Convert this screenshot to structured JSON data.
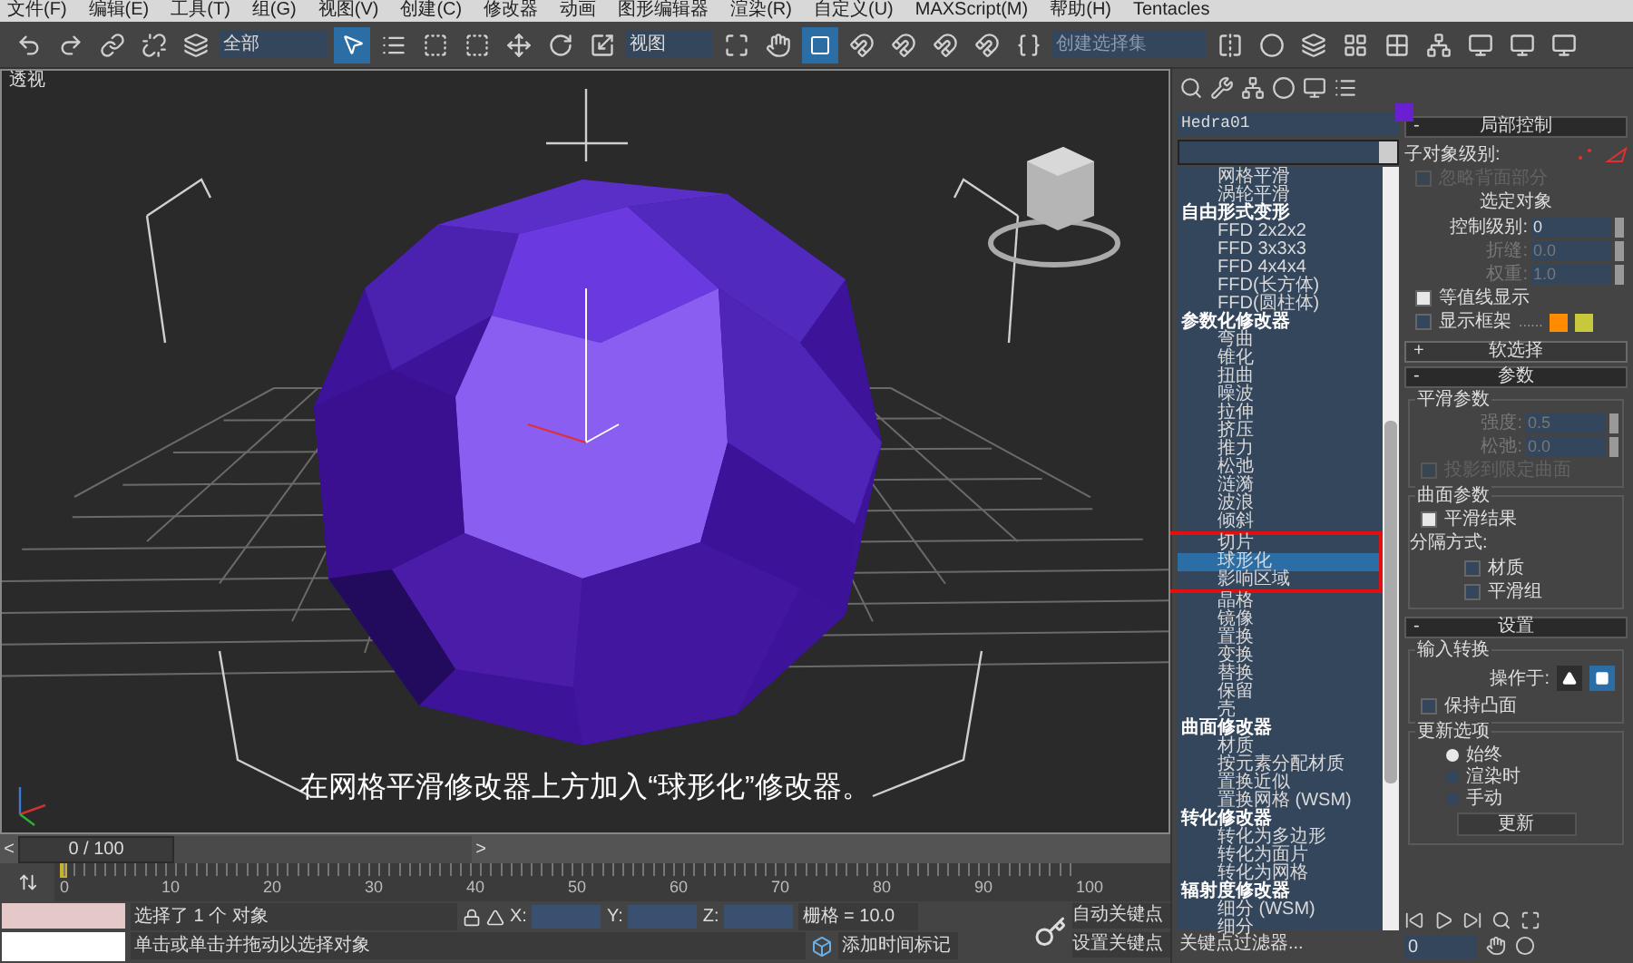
{
  "menu": [
    "文件(F)",
    "编辑(E)",
    "工具(T)",
    "组(G)",
    "视图(V)",
    "创建(C)",
    "修改器",
    "动画",
    "图形编辑器",
    "渲染(R)",
    "自定义(U)",
    "MAXScript(M)",
    "帮助(H)",
    "Tentacles"
  ],
  "toolbar": {
    "selection_filter": "全部",
    "reference_coord": "视图",
    "named_selection_placeholder": "创建选择集"
  },
  "viewport": {
    "label": "透视",
    "caption": "在网格平滑修改器上方加入“球形化”修改器。"
  },
  "command_panel": {
    "object": {
      "name": "Hedra01",
      "color": "#6a1fd0"
    },
    "modifier_list": [
      {
        "kind": "item",
        "label": "网格平滑",
        "selected": false,
        "marked": false
      },
      {
        "kind": "item",
        "label": "涡轮平滑",
        "selected": false,
        "marked": false
      },
      {
        "kind": "header",
        "label": "自由形式变形",
        "selected": false,
        "marked": false
      },
      {
        "kind": "item",
        "label": "FFD 2x2x2",
        "selected": false,
        "marked": false
      },
      {
        "kind": "item",
        "label": "FFD 3x3x3",
        "selected": false,
        "marked": false
      },
      {
        "kind": "item",
        "label": "FFD 4x4x4",
        "selected": false,
        "marked": false
      },
      {
        "kind": "item",
        "label": "FFD(长方体)",
        "selected": false,
        "marked": false
      },
      {
        "kind": "item",
        "label": "FFD(圆柱体)",
        "selected": false,
        "marked": false
      },
      {
        "kind": "header",
        "label": "参数化修改器",
        "selected": false,
        "marked": false
      },
      {
        "kind": "item",
        "label": "弯曲",
        "selected": false,
        "marked": false
      },
      {
        "kind": "item",
        "label": "锥化",
        "selected": false,
        "marked": false
      },
      {
        "kind": "item",
        "label": "扭曲",
        "selected": false,
        "marked": false
      },
      {
        "kind": "item",
        "label": "噪波",
        "selected": false,
        "marked": false
      },
      {
        "kind": "item",
        "label": "拉伸",
        "selected": false,
        "marked": false
      },
      {
        "kind": "item",
        "label": "挤压",
        "selected": false,
        "marked": false
      },
      {
        "kind": "item",
        "label": "推力",
        "selected": false,
        "marked": false
      },
      {
        "kind": "item",
        "label": "松弛",
        "selected": false,
        "marked": false
      },
      {
        "kind": "item",
        "label": "涟漪",
        "selected": false,
        "marked": false
      },
      {
        "kind": "item",
        "label": "波浪",
        "selected": false,
        "marked": false
      },
      {
        "kind": "item",
        "label": "倾斜",
        "selected": false,
        "marked": false
      },
      {
        "kind": "item",
        "label": "切片",
        "selected": false,
        "marked": true
      },
      {
        "kind": "item",
        "label": "球形化",
        "selected": true,
        "marked": true
      },
      {
        "kind": "item",
        "label": "影响区域",
        "selected": false,
        "marked": true
      },
      {
        "kind": "item",
        "label": "晶格",
        "selected": false,
        "marked": false
      },
      {
        "kind": "item",
        "label": "镜像",
        "selected": false,
        "marked": false
      },
      {
        "kind": "item",
        "label": "置换",
        "selected": false,
        "marked": false
      },
      {
        "kind": "item",
        "label": "变换",
        "selected": false,
        "marked": false
      },
      {
        "kind": "item",
        "label": "替换",
        "selected": false,
        "marked": false
      },
      {
        "kind": "item",
        "label": "保留",
        "selected": false,
        "marked": false
      },
      {
        "kind": "item",
        "label": "壳",
        "selected": false,
        "marked": false
      },
      {
        "kind": "header",
        "label": "曲面修改器",
        "selected": false,
        "marked": false
      },
      {
        "kind": "item",
        "label": "材质",
        "selected": false,
        "marked": false
      },
      {
        "kind": "item",
        "label": "按元素分配材质",
        "selected": false,
        "marked": false
      },
      {
        "kind": "item",
        "label": "置换近似",
        "selected": false,
        "marked": false
      },
      {
        "kind": "item",
        "label": "置换网格 (WSM)",
        "selected": false,
        "marked": false
      },
      {
        "kind": "header",
        "label": "转化修改器",
        "selected": false,
        "marked": false
      },
      {
        "kind": "item",
        "label": "转化为多边形",
        "selected": false,
        "marked": false
      },
      {
        "kind": "item",
        "label": "转化为面片",
        "selected": false,
        "marked": false
      },
      {
        "kind": "item",
        "label": "转化为网格",
        "selected": false,
        "marked": false
      },
      {
        "kind": "header",
        "label": "辐射度修改器",
        "selected": false,
        "marked": false
      },
      {
        "kind": "item",
        "label": "细分 (WSM)",
        "selected": false,
        "marked": false
      },
      {
        "kind": "item",
        "label": "细分",
        "selected": false,
        "marked": false
      }
    ]
  },
  "rollouts": [
    {
      "toggle": "-",
      "title": "局部控制",
      "expanded": true,
      "items": [
        {
          "kind": "subobj",
          "label": "子对象级别:"
        },
        {
          "kind": "checkbox",
          "label": "忽略背面部分",
          "checked": false,
          "disabled": true
        },
        {
          "kind": "heading",
          "label": "选定对象"
        },
        {
          "kind": "spinner",
          "label": "控制级别:",
          "value": "0",
          "disabled": false
        },
        {
          "kind": "spinner",
          "label": "折缝:",
          "value": "0.0",
          "disabled": true
        },
        {
          "kind": "spinner",
          "label": "权重:",
          "value": "1.0",
          "disabled": true
        },
        {
          "kind": "checkbox",
          "label": "等值线显示",
          "checked": true,
          "disabled": false
        },
        {
          "kind": "cage",
          "label": "显示框架",
          "checked": false,
          "disabled": false,
          "dots": "......"
        }
      ]
    },
    {
      "toggle": "+",
      "title": "软选择",
      "expanded": false
    },
    {
      "toggle": "-",
      "title": "参数",
      "expanded": true,
      "items": [
        {
          "kind": "group",
          "label": "平滑参数",
          "items": [
            {
              "kind": "spinner",
              "label": "强度:",
              "value": "0.5",
              "disabled": true
            },
            {
              "kind": "spinner",
              "label": "松弛:",
              "value": "0.0",
              "disabled": true
            },
            {
              "kind": "checkbox",
              "label": "投影到限定曲面",
              "checked": false,
              "disabled": true
            }
          ]
        },
        {
          "kind": "group",
          "label": "曲面参数",
          "items": [
            {
              "kind": "checkbox",
              "label": "平滑结果",
              "checked": true,
              "disabled": false
            },
            {
              "kind": "heading",
              "label": "分隔方式:"
            },
            {
              "kind": "subcheckbox",
              "label": "材质",
              "checked": false,
              "disabled": false
            },
            {
              "kind": "subcheckbox",
              "label": "平滑组",
              "checked": false,
              "disabled": false
            }
          ]
        }
      ]
    },
    {
      "toggle": "-",
      "title": "设置",
      "expanded": true,
      "items": [
        {
          "kind": "group",
          "label": "输入转换",
          "items": [
            {
              "kind": "operate",
              "label": "操作于:",
              "options": [
                {
                  "selected": false
                },
                {
                  "selected": true
                }
              ]
            },
            {
              "kind": "checkbox",
              "label": "保持凸面",
              "checked": false,
              "disabled": false
            }
          ]
        },
        {
          "kind": "group",
          "label": "更新选项",
          "items": [
            {
              "kind": "radio",
              "label": "始终",
              "selected": true
            },
            {
              "kind": "radio",
              "label": "渲染时",
              "selected": false
            },
            {
              "kind": "radio",
              "label": "手动",
              "selected": false
            },
            {
              "kind": "button",
              "label": "更新"
            }
          ]
        }
      ]
    }
  ],
  "timeline": {
    "position": "0 / 100",
    "prev": "<",
    "next": ">",
    "ticks": [
      "0",
      "10",
      "20",
      "30",
      "40",
      "50",
      "60",
      "70",
      "80",
      "90",
      "100"
    ]
  },
  "status_bar": {
    "selection_info": "选择了 1 个 对象",
    "prompt": "单击或单击并拖动以选择对象",
    "x_label": "X:",
    "y_label": "Y:",
    "z_label": "Z:",
    "grid": "栅格 = 10.0",
    "add_time_tag": "添加时间标记",
    "auto_key": "自动关键点",
    "set_key": "设置关键点",
    "key_filters": "关键点过滤器...",
    "frame": "0"
  }
}
